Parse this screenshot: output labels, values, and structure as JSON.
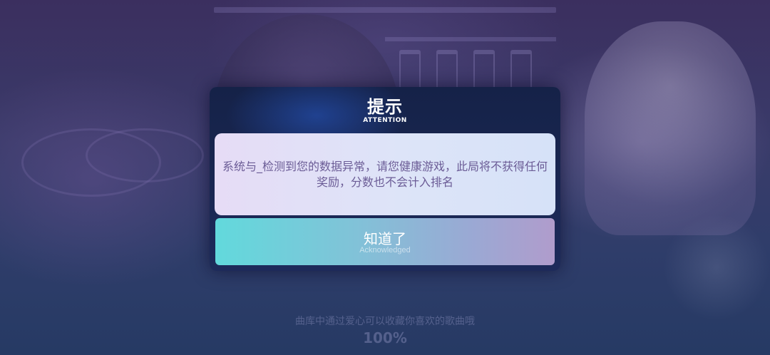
{
  "dialog": {
    "title": "提示",
    "subtitle": "ATTENTION",
    "message": "系统与_检测到您的数据异常，请您健康游戏，此局将不获得任何奖励，分数也不会计入排名",
    "button_label": "知道了",
    "button_sublabel": "Acknowledged"
  },
  "background": {
    "hint_text": "曲库中通过爱心可以收藏你喜欢的歌曲哦",
    "progress_text": "100%"
  },
  "colors": {
    "dialog_bg": "#1d2a5a",
    "message_text": "#6b5c96",
    "button_gradient_start": "#62d9dc",
    "button_gradient_end": "#b09ccc"
  }
}
